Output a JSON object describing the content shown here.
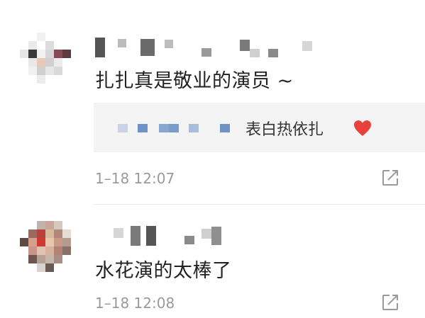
{
  "comments": [
    {
      "text": "扎扎真是敬业的演员 ~",
      "reply": {
        "text": "表白热依扎",
        "icon": "heart-icon",
        "heart_color": "#e8413c"
      },
      "time": "1–18 12:07",
      "share_icon": "share-icon"
    },
    {
      "text": "水花演的太棒了",
      "time": "1–18 12:08",
      "share_icon": "share-icon"
    }
  ],
  "colors": {
    "text": "#222222",
    "meta": "#9a9a9a",
    "reply_bg": "#f4f4f4",
    "reply_name": "#5b86c4",
    "divider": "#e9e9e9"
  }
}
